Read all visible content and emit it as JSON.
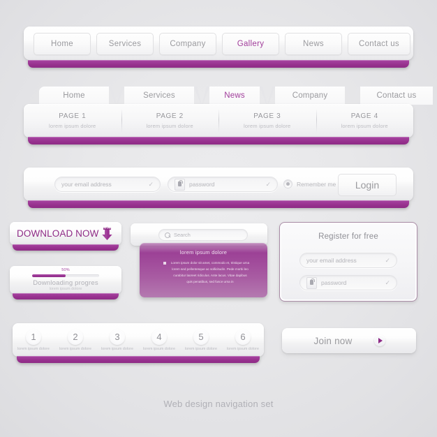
{
  "theme": {
    "accent": "#9b3393",
    "accent_light": "#a744a2",
    "background": "#e6e6e9",
    "text_muted": "#9a9a9e"
  },
  "nav_buttons": {
    "items": [
      {
        "label": "Home",
        "active": false
      },
      {
        "label": "Services",
        "active": false
      },
      {
        "label": "Company",
        "active": false
      },
      {
        "label": "Gallery",
        "active": true
      },
      {
        "label": "News",
        "active": false
      },
      {
        "label": "Contact us",
        "active": false
      }
    ]
  },
  "nav_tabs": {
    "tabs": [
      {
        "label": "Home",
        "active": false
      },
      {
        "label": "Services",
        "active": false
      },
      {
        "label": "News",
        "active": true
      },
      {
        "label": "Company",
        "active": false
      },
      {
        "label": "Contact us",
        "active": false
      }
    ],
    "pages": [
      {
        "title": "PAGE 1",
        "sub": "lorem ipsum dolore"
      },
      {
        "title": "PAGE 2",
        "sub": "lorem ipsum dolore"
      },
      {
        "title": "PAGE 3",
        "sub": "lorem ipsum dolore"
      },
      {
        "title": "PAGE 4",
        "sub": "lorem ipsum dolore"
      }
    ]
  },
  "login": {
    "email_placeholder": "your email address",
    "email_value": "",
    "password_placeholder": "password",
    "password_value": "",
    "valid_mark": "✓",
    "remember_label": "Remember me",
    "button_label": "Login"
  },
  "download": {
    "label": "DOWNLOAD NOW",
    "icon": "download-arrow-icon"
  },
  "progress": {
    "percent_label": "50%",
    "percent_value": 50,
    "title": "Downloading progres",
    "sub": "lorem ipsum dolore"
  },
  "search": {
    "placeholder": "Search",
    "value": "",
    "icon": "magnifier-icon"
  },
  "dropdown": {
    "title": "lorem ipsum dolore",
    "body": "Lorem ipsum dolor sit amet, commodo et, tristique urna lorem sed pellentesque ac sollicitudin. Pede morbi leo curabitur laoreet ridiculus. Ante lacus. Vitae dapibus quis penatibus, sed fusce urna in"
  },
  "register": {
    "title": "Register for free",
    "email_placeholder": "your email address",
    "email_value": "",
    "password_placeholder": "password",
    "password_value": "",
    "valid_mark": "✓"
  },
  "steps": {
    "items": [
      {
        "number": "1",
        "sub": "lorem ipsum dolore"
      },
      {
        "number": "2",
        "sub": "lorem ipsum dolore"
      },
      {
        "number": "3",
        "sub": "lorem ipsum dolore"
      },
      {
        "number": "4",
        "sub": "lorem ipsum dolore"
      },
      {
        "number": "5",
        "sub": "lorem ipsum dolore"
      },
      {
        "number": "6",
        "sub": "lorem ipsum dolore"
      }
    ]
  },
  "join": {
    "label": "Join now",
    "icon": "play-arrow-icon"
  },
  "caption": "Web design navigation set"
}
